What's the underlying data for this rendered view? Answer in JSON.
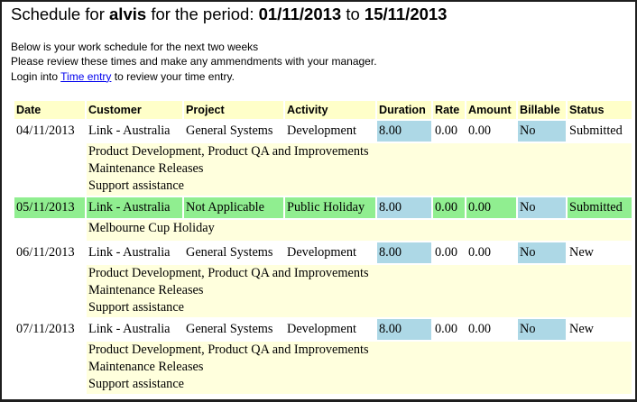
{
  "header": {
    "prefix": "Schedule for",
    "user": "alvis",
    "middle": "for the period:",
    "start": "01/11/2013",
    "to": "to",
    "end": "15/11/2013"
  },
  "intro": {
    "line1": "Below is your work schedule for the next two weeks",
    "line2": "Please review these times and make any ammendments with your manager.",
    "line3_pre": "Login into",
    "link": "Time entry",
    "line3_post": "to review your time entry."
  },
  "columns": [
    "Date",
    "Customer",
    "Project",
    "Activity",
    "Duration",
    "Rate",
    "Amount",
    "Billable",
    "Status"
  ],
  "rows": [
    {
      "date": "04/11/2013",
      "customer": "Link - Australia",
      "project": "General Systems",
      "activity": "Development",
      "duration": "8.00",
      "rate": "0.00",
      "amount": "0.00",
      "billable": "No",
      "status": "Submitted",
      "notes": [
        "Product Development, Product QA and Improvements",
        "Maintenance Releases",
        "Support assistance"
      ]
    },
    {
      "date": "05/11/2013",
      "customer": "Link - Australia",
      "project": "Not Applicable",
      "activity": "Public Holiday",
      "duration": "8.00",
      "rate": "0.00",
      "amount": "0.00",
      "billable": "No",
      "status": "Submitted",
      "notes": [
        "Melbourne Cup Holiday"
      ]
    },
    {
      "date": "06/11/2013",
      "customer": "Link - Australia",
      "project": "General Systems",
      "activity": "Development",
      "duration": "8.00",
      "rate": "0.00",
      "amount": "0.00",
      "billable": "No",
      "status": "New",
      "notes": [
        "Product Development, Product QA and Improvements",
        "Maintenance Releases",
        "Support assistance"
      ]
    },
    {
      "date": "07/11/2013",
      "customer": "Link - Australia",
      "project": "General Systems",
      "activity": "Development",
      "duration": "8.00",
      "rate": "0.00",
      "amount": "0.00",
      "billable": "No",
      "status": "New",
      "notes": [
        "Product Development, Product QA and Improvements",
        "Maintenance Releases",
        "Support assistance"
      ]
    }
  ],
  "colors": {
    "header_bg": "#ffffc9",
    "note_bg": "#ffffdd",
    "holiday_bg": "#90ee90",
    "highlight_bg": "#add8e6",
    "link": "#0000ee"
  }
}
